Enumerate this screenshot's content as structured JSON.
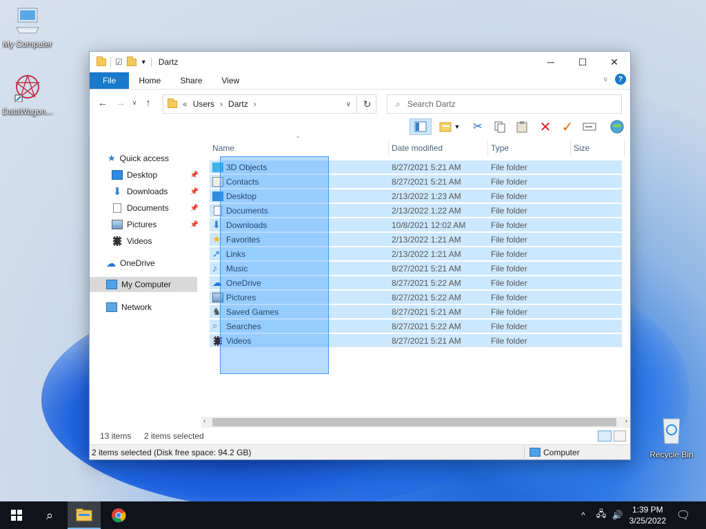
{
  "desktop": {
    "icons": [
      {
        "label": "My Computer"
      },
      {
        "label": "DataWagon..."
      },
      {
        "label": "Recycle Bin"
      }
    ]
  },
  "window": {
    "title": "Dartz",
    "tabs": {
      "file": "File",
      "home": "Home",
      "share": "Share",
      "view": "View"
    },
    "address": {
      "prefix": "«",
      "crumbs": [
        "Users",
        "Dartz"
      ]
    },
    "search": {
      "placeholder": "Search Dartz"
    },
    "nav": {
      "quick_access": "Quick access",
      "items": [
        "Desktop",
        "Downloads",
        "Documents",
        "Pictures",
        "Videos"
      ],
      "onedrive": "OneDrive",
      "my_computer": "My Computer",
      "network": "Network"
    },
    "columns": {
      "name": "Name",
      "date": "Date modified",
      "type": "Type",
      "size": "Size"
    },
    "rows": [
      {
        "name": "3D Objects",
        "date": "8/27/2021 5:21 AM",
        "type": "File folder"
      },
      {
        "name": "Contacts",
        "date": "8/27/2021 5:21 AM",
        "type": "File folder"
      },
      {
        "name": "Desktop",
        "date": "2/13/2022 1:23 AM",
        "type": "File folder"
      },
      {
        "name": "Documents",
        "date": "2/13/2022 1:22 AM",
        "type": "File folder"
      },
      {
        "name": "Downloads",
        "date": "10/8/2021 12:02 AM",
        "type": "File folder"
      },
      {
        "name": "Favorites",
        "date": "2/13/2022 1:21 AM",
        "type": "File folder"
      },
      {
        "name": "Links",
        "date": "2/13/2022 1:21 AM",
        "type": "File folder"
      },
      {
        "name": "Music",
        "date": "8/27/2021 5:21 AM",
        "type": "File folder"
      },
      {
        "name": "OneDrive",
        "date": "8/27/2021 5:22 AM",
        "type": "File folder"
      },
      {
        "name": "Pictures",
        "date": "8/27/2021 5:22 AM",
        "type": "File folder"
      },
      {
        "name": "Saved Games",
        "date": "8/27/2021 5:21 AM",
        "type": "File folder"
      },
      {
        "name": "Searches",
        "date": "8/27/2021 5:22 AM",
        "type": "File folder"
      },
      {
        "name": "Videos",
        "date": "8/27/2021 5:21 AM",
        "type": "File folder"
      }
    ],
    "status": {
      "count": "13 items",
      "selected": "2 items selected"
    },
    "info": {
      "text": "2 items selected (Disk free space: 94.2 GB)",
      "location": "Computer"
    }
  },
  "taskbar": {
    "time": "1:39 PM",
    "date": "3/25/2022"
  }
}
